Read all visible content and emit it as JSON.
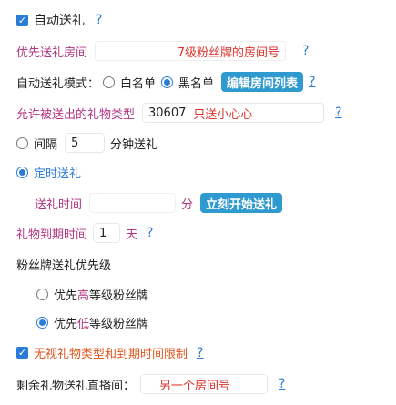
{
  "auto_gift": {
    "checked": true,
    "label": "自动送礼",
    "help": "?"
  },
  "priority_room": {
    "label": "优先送礼房间",
    "value": "",
    "suffix": "7级粉丝牌的房间号",
    "help": "?"
  },
  "mode": {
    "label": "自动送礼模式：",
    "whitelist_label": "白名单",
    "blacklist_label": "黑名单",
    "selected": "blacklist",
    "edit_button": "编辑房间列表",
    "help": "?"
  },
  "allowed_types": {
    "label": "允许被送出的礼物类型",
    "value": "30607",
    "note": "只送小心心",
    "help": "?"
  },
  "interval": {
    "label": "间隔",
    "value": "5",
    "unit": "分钟送礼"
  },
  "scheduled": {
    "label": "定时送礼",
    "time_label": "送礼时间",
    "time_value": "",
    "time_unit": "分",
    "start_button": "立刻开始送礼"
  },
  "expiry": {
    "label": "礼物到期时间",
    "value": "1",
    "unit": "天",
    "help": "?"
  },
  "badge_priority": {
    "label": "粉丝牌送礼优先级",
    "high_prefix": "优先",
    "high_em": "高",
    "high_suffix": "等级粉丝牌",
    "low_prefix": "优先",
    "low_em": "低",
    "low_suffix": "等级粉丝牌",
    "selected": "low"
  },
  "ignore_limits": {
    "checked": true,
    "label": "无视礼物类型和到期时间限制",
    "help": "?"
  },
  "remaining_room": {
    "label": "剩余礼物送礼直播间：",
    "value": "另一个房间号",
    "help": "?"
  },
  "colors": {
    "accent": "#2b7bd8",
    "button": "#2e9ad0",
    "magenta": "#b0347f",
    "orange": "#e0541b",
    "red": "#e0312a"
  }
}
